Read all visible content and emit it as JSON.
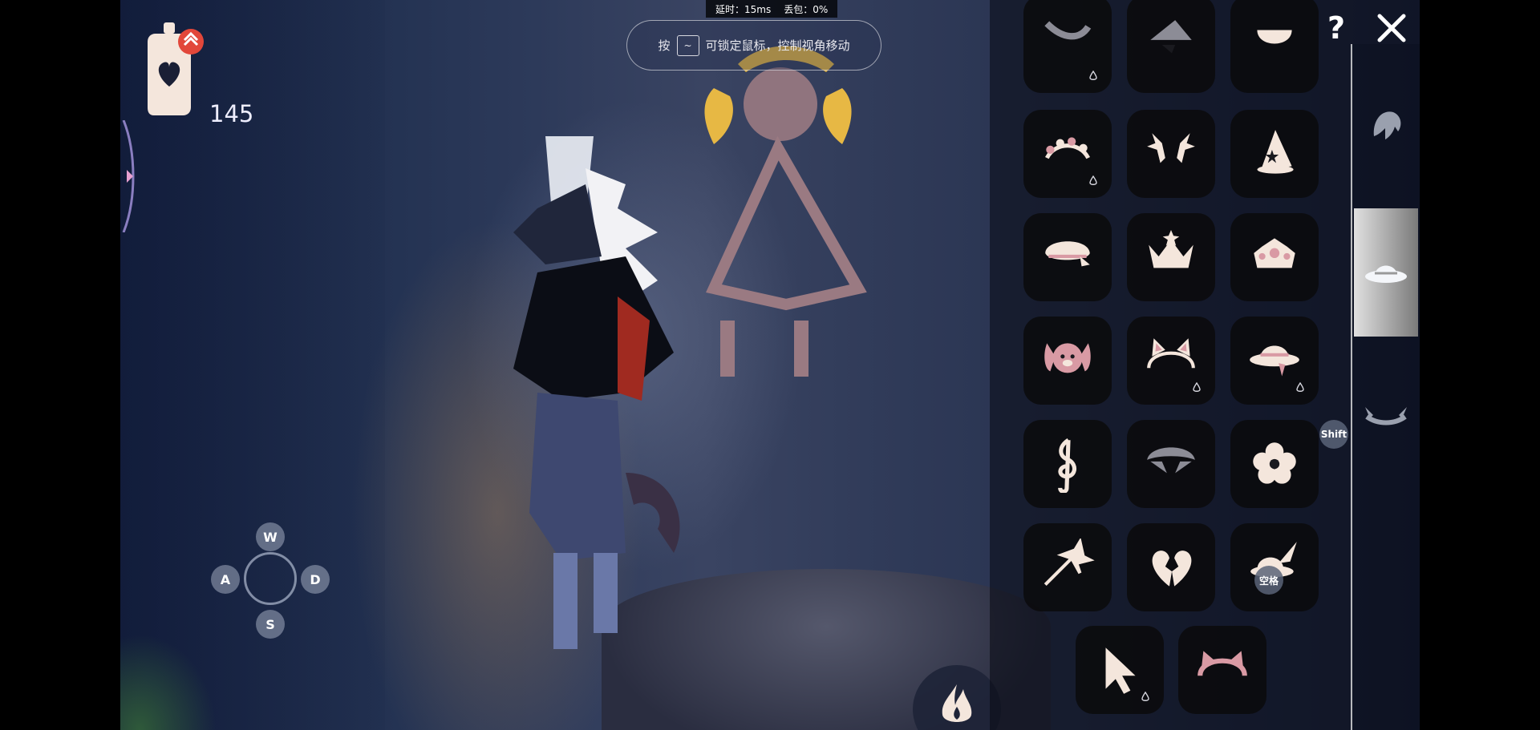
{
  "status": {
    "latency": "延时：15ms",
    "packet_loss": "丢包：0%"
  },
  "lock_hint": {
    "prefix": "按",
    "key": "~",
    "text": "可锁定鼠标，控制视角移动"
  },
  "candles": {
    "count": "145"
  },
  "controls": {
    "w": "W",
    "a": "A",
    "s": "S",
    "d": "D"
  },
  "panel": {
    "help": "?",
    "shift_key": "Shift",
    "space_key": "空格",
    "categories": [
      {
        "name": "hair-icon",
        "active": false
      },
      {
        "name": "hat-icon",
        "active": true
      },
      {
        "name": "horns-icon",
        "active": false
      }
    ],
    "items": [
      {
        "name": "partial-item-icon",
        "drop": true
      },
      {
        "name": "witch-hat-icon",
        "drop": false
      },
      {
        "name": "bun-icon",
        "drop": false
      },
      {
        "name": "flower-crown-icon",
        "drop": true
      },
      {
        "name": "antlers-icon",
        "drop": false
      },
      {
        "name": "party-hat-icon",
        "drop": false
      },
      {
        "name": "beret-icon",
        "drop": false
      },
      {
        "name": "crown-icon",
        "drop": false
      },
      {
        "name": "jeweled-crown-icon",
        "drop": false
      },
      {
        "name": "bunny-hood-icon",
        "drop": false
      },
      {
        "name": "cat-ears-icon",
        "drop": true
      },
      {
        "name": "sun-hat-icon",
        "drop": true
      },
      {
        "name": "treble-clef-icon",
        "drop": false
      },
      {
        "name": "wing-cap-icon",
        "drop": false
      },
      {
        "name": "flower-icon",
        "drop": false
      },
      {
        "name": "arrow-feather-icon",
        "drop": false
      },
      {
        "name": "split-heart-icon",
        "drop": false
      },
      {
        "name": "feather-hat-icon",
        "drop": false
      },
      {
        "name": "cursor-icon",
        "drop": true
      },
      {
        "name": "headband-ears-icon",
        "drop": false
      }
    ]
  },
  "colors": {
    "accent": "#f2e4da",
    "badge": "#e2473a",
    "cream": "#f4e6dc"
  }
}
